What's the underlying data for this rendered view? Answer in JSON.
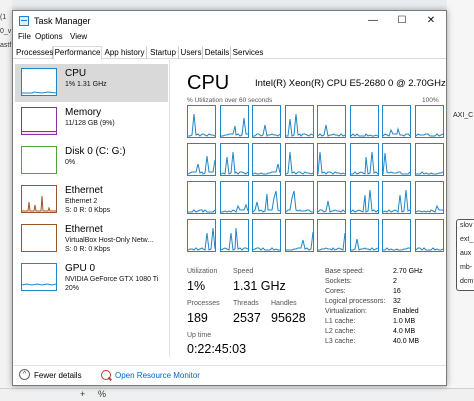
{
  "background": {
    "left_fragments": [
      "(1",
      "0_v",
      "astf"
    ],
    "right_fragments": [
      "AXI_C",
      "slov",
      "ext_",
      "aux",
      "mb-",
      "dcm"
    ],
    "bottom_buttons": [
      "+",
      "%"
    ]
  },
  "window": {
    "title": "Task Manager",
    "controls": {
      "minimize": "—",
      "maximize": "☐",
      "close": "✕"
    }
  },
  "menu": [
    "File",
    "Options",
    "View"
  ],
  "tabs": [
    {
      "label": "Processes",
      "active": false
    },
    {
      "label": "Performance",
      "active": true
    },
    {
      "label": "App history",
      "active": false
    },
    {
      "label": "Startup",
      "active": false
    },
    {
      "label": "Users",
      "active": false
    },
    {
      "label": "Details",
      "active": false
    },
    {
      "label": "Services",
      "active": false
    }
  ],
  "sidebar": [
    {
      "name": "CPU",
      "lines": [
        "1% 1.31 GHz"
      ],
      "color": "#1f86c7",
      "selected": true
    },
    {
      "name": "Memory",
      "lines": [
        "11/128 GB (9%)"
      ],
      "color": "#8b2da3",
      "selected": false
    },
    {
      "name": "Disk 0 (C: G:)",
      "lines": [
        "0%"
      ],
      "color": "#4ca832",
      "selected": false
    },
    {
      "name": "Ethernet",
      "lines": [
        "Ethernet 2",
        "S: 0 R: 0 Kbps"
      ],
      "color": "#a0522d",
      "selected": false
    },
    {
      "name": "Ethernet",
      "lines": [
        "VirtualBox Host-Only Netw...",
        "S: 0 R: 0 Kbps"
      ],
      "color": "#a0522d",
      "selected": false
    },
    {
      "name": "GPU 0",
      "lines": [
        "NVIDIA GeForce GTX 1080 Ti",
        "20%"
      ],
      "color": "#1f86c7",
      "selected": false
    }
  ],
  "cpu": {
    "title": "CPU",
    "model": "Intel(R) Xeon(R) CPU E5-2680 0 @ 2.70GHz",
    "util_label": "% Utilization over 60 seconds",
    "util_max": "100%",
    "graph_color": "#1f86c7",
    "logical_processor_graphs": 32
  },
  "stats": {
    "utilization_label": "Utilization",
    "utilization": "1%",
    "speed_label": "Speed",
    "speed": "1.31 GHz",
    "processes_label": "Processes",
    "processes": "189",
    "threads_label": "Threads",
    "threads": "2537",
    "handles_label": "Handles",
    "handles": "95628",
    "uptime_label": "Up time",
    "uptime": "0:22:45:03"
  },
  "specs": [
    {
      "key": "Base speed:",
      "value": "2.70 GHz"
    },
    {
      "key": "Sockets:",
      "value": "2"
    },
    {
      "key": "Cores:",
      "value": "16"
    },
    {
      "key": "Logical processors:",
      "value": "32"
    },
    {
      "key": "Virtualization:",
      "value": "Enabled"
    },
    {
      "key": "L1 cache:",
      "value": "1.0 MB"
    },
    {
      "key": "L2 cache:",
      "value": "4.0 MB"
    },
    {
      "key": "L3 cache:",
      "value": "40.0 MB"
    }
  ],
  "footer": {
    "fewer_details": "Fewer details",
    "open_resource_monitor": "Open Resource Monitor"
  }
}
